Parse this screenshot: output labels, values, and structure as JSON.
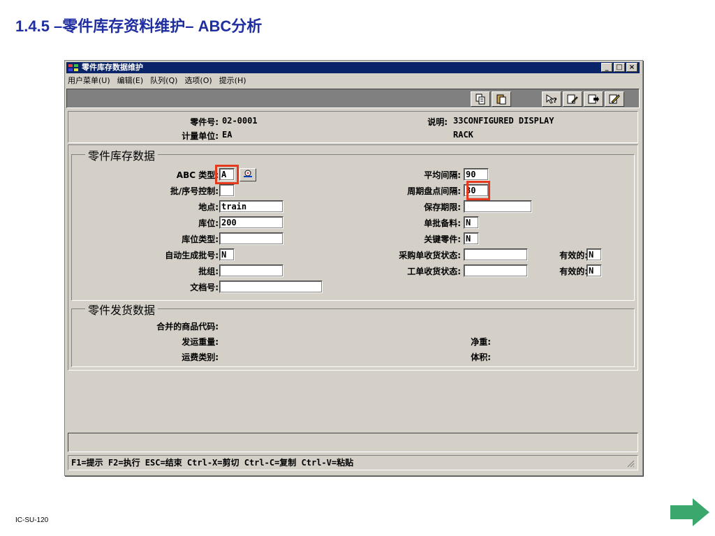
{
  "slide": {
    "title": "1.4.5 –零件库存资料维护– ABC分析",
    "footer_code": "IC-SU-120"
  },
  "window": {
    "title": "零件库存数据维护",
    "controls": {
      "minimize": "_",
      "maximize": "□",
      "close": "×"
    },
    "menu": [
      "用户菜单(U)",
      "编辑(E)",
      "队列(Q)",
      "选项(O)",
      "提示(H)"
    ],
    "toolbar_icons": [
      "copy-icon",
      "paste-icon",
      "help-query-icon",
      "edit-icon",
      "go-icon",
      "exit-icon"
    ]
  },
  "header": {
    "part_no_label": "零件号:",
    "part_no": "02-0001",
    "uom_label": "计量单位:",
    "uom": "EA",
    "desc_label": "说明:",
    "desc_line1": "33CONFIGURED DISPLAY",
    "desc_line2": "RACK"
  },
  "inventory": {
    "group_title": "零件库存数据",
    "abc_label": "ABC 类型:",
    "abc_value": "A",
    "lot_serial_label": "批/序号控制:",
    "lot_serial_value": "",
    "site_label": "地点:",
    "site_value": "train",
    "location_label": "库位:",
    "location_value": "200",
    "loc_type_label": "库位类型:",
    "loc_type_value": "",
    "auto_lot_label": "自动生成批号:",
    "auto_lot_value": "N",
    "lot_group_label": "批组:",
    "lot_group_value": "",
    "doc_no_label": "文档号:",
    "doc_no_value": "",
    "avg_interval_label": "平均间隔:",
    "avg_interval_value": "90",
    "cycle_count_label": "周期盘点间隔:",
    "cycle_count_value": "30",
    "shelf_life_label": "保存期限:",
    "shelf_life_value": "",
    "single_lot_label": "单批备料:",
    "single_lot_value": "N",
    "key_item_label": "关键零件:",
    "key_item_value": "N",
    "po_rcpt_label": "采购单收货状态:",
    "po_rcpt_value": "",
    "po_active_label": "有效的:",
    "po_active_value": "N",
    "wo_rcpt_label": "工单收货状态:",
    "wo_rcpt_value": "",
    "wo_active_label": "有效的:",
    "wo_active_value": "N"
  },
  "shipping": {
    "group_title": "零件发货数据",
    "commodity_label": "合并的商品代码:",
    "ship_weight_label": "发运重量:",
    "freight_class_label": "运费类别:",
    "net_weight_label": "净重:",
    "volume_label": "体积:"
  },
  "statusbar": {
    "text": "F1=提示 F2=执行 ESC=结束 Ctrl-X=剪切 Ctrl-C=复制 Ctrl-V=粘贴"
  },
  "colors": {
    "title_blue": "#1f2ea0",
    "highlight_red": "#e53a1d",
    "next_arrow_green": "#3aa76d",
    "titlebar_navy": "#0a246a"
  }
}
